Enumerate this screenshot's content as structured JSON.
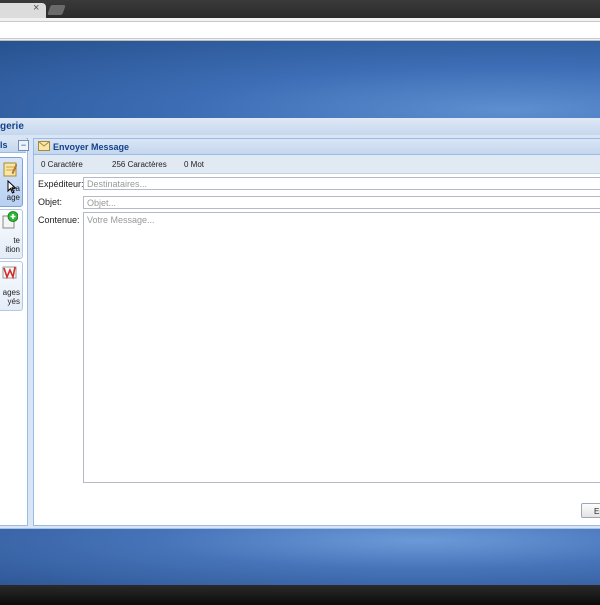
{
  "browser": {
    "tab_close_glyph": "×",
    "new_tab_icon": "new-tab-icon"
  },
  "app": {
    "title_fragment": "gerie"
  },
  "sidebar": {
    "title_fragment": "ls",
    "collapse_glyph": "−",
    "items": [
      {
        "label_lines": [
          "ea",
          "age"
        ],
        "icon": "new-message-icon",
        "selected": true
      },
      {
        "label_lines": [
          "te",
          "ition"
        ],
        "icon": "add-contact-icon",
        "selected": false
      },
      {
        "label_lines": [
          "ages",
          "yés"
        ],
        "icon": "sent-messages-icon",
        "selected": false
      }
    ]
  },
  "compose": {
    "title": "Envoyer Message",
    "counters": {
      "chars": "0 Caractère",
      "remaining": "256 Caractères",
      "words": "0 Mot"
    },
    "sender_label": "Expéditeur:",
    "recipients_placeholder": "Destinataires...",
    "subject_label": "Objet:",
    "subject_placeholder": "Objet...",
    "content_label": "Contenue:",
    "content_placeholder": "Votre Message...",
    "send_label": "En"
  },
  "colors": {
    "banner": "#3d6db5",
    "panel_title": "#15428b",
    "panel_border": "#99bbe8"
  }
}
